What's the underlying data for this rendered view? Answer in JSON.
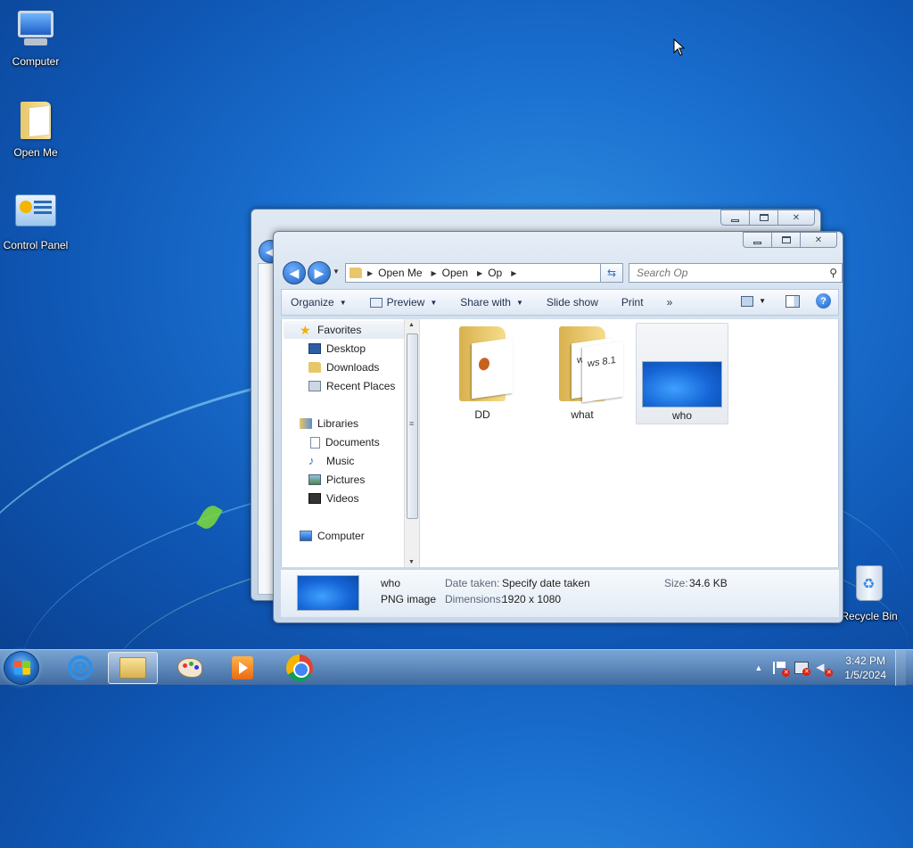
{
  "desktop": {
    "icons": [
      {
        "label": "Computer"
      },
      {
        "label": "Open Me"
      },
      {
        "label": "Control Panel"
      },
      {
        "label": "Recycle Bin"
      }
    ]
  },
  "explorer": {
    "breadcrumb": [
      "Open Me",
      "Open",
      "Op"
    ],
    "search_placeholder": "Search Op",
    "toolbar": {
      "organize": "Organize",
      "preview": "Preview",
      "share_with": "Share with",
      "slide_show": "Slide show",
      "print": "Print",
      "more": "»"
    },
    "nav": {
      "favorites": "Favorites",
      "desktop": "Desktop",
      "downloads": "Downloads",
      "recent_places": "Recent Places",
      "libraries": "Libraries",
      "documents": "Documents",
      "music": "Music",
      "pictures": "Pictures",
      "videos": "Videos",
      "computer": "Computer"
    },
    "files": [
      {
        "name": "DD",
        "type": "folder"
      },
      {
        "name": "what",
        "type": "folder",
        "paper_text": "ws 8.1"
      },
      {
        "name": "who",
        "type": "image",
        "selected": true
      }
    ],
    "details": {
      "name": "who",
      "file_type": "PNG image",
      "date_taken_label": "Date taken:",
      "date_taken_value": "Specify date taken",
      "dimensions_label": "Dimensions:",
      "dimensions_value": "1920 x 1080",
      "size_label": "Size:",
      "size_value": "34.6 KB"
    }
  },
  "taskbar": {
    "time": "3:42 PM",
    "date": "1/5/2024"
  },
  "colors": {
    "wallpaper": "#1a6fcf",
    "accent": "#2d6fc4",
    "folder": "#e8c76a"
  }
}
